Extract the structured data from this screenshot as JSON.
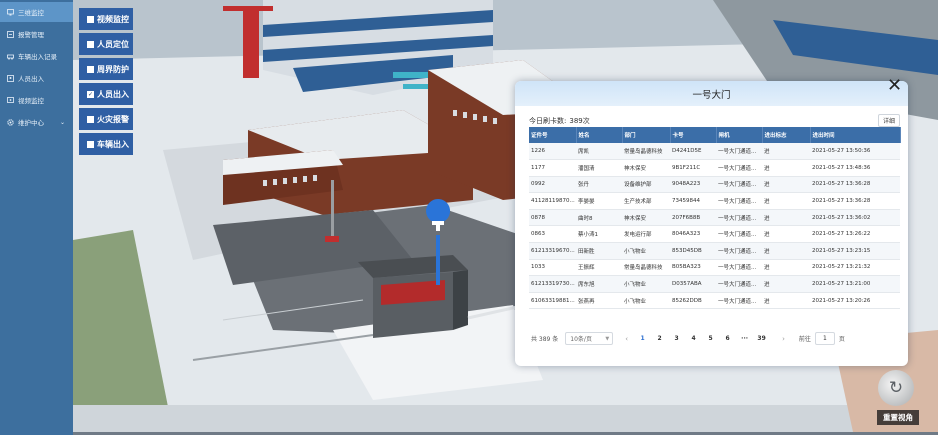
{
  "sidebar": {
    "items": [
      {
        "label": "三维监控",
        "icon": "monitor-icon"
      },
      {
        "label": "报警管理",
        "icon": "alarm-icon"
      },
      {
        "label": "车辆出入记录",
        "icon": "vehicle-icon"
      },
      {
        "label": "人员出入",
        "icon": "person-icon"
      },
      {
        "label": "视频监控",
        "icon": "video-icon"
      },
      {
        "label": "维护中心",
        "icon": "gear-icon"
      }
    ]
  },
  "layers": [
    {
      "label": "视频监控",
      "checked": false
    },
    {
      "label": "人员定位",
      "checked": false
    },
    {
      "label": "周界防护",
      "checked": false
    },
    {
      "label": "人员出入",
      "checked": true
    },
    {
      "label": "火灾报警",
      "checked": false
    },
    {
      "label": "车辆出入",
      "checked": false
    }
  ],
  "dialog": {
    "title": "一号大门",
    "count_label": "今日刷卡数:",
    "count_value": "389次",
    "detail_label": "详细",
    "columns": [
      "证件号",
      "姓名",
      "部门",
      "卡号",
      "闸机",
      "进出标志",
      "进出时间"
    ],
    "rows": [
      [
        "1226",
        "席凯",
        "常量岛晶德科技",
        "D4241D5E",
        "一号大门通道...",
        "进",
        "2021-05-27 13:50:36"
      ],
      [
        "1177",
        "潘国清",
        "神木保安",
        "9B1F211C",
        "一号大门通道...",
        "进",
        "2021-05-27 13:48:36"
      ],
      [
        "0992",
        "张丹",
        "设备维护部",
        "9048A223",
        "一号大门通道...",
        "进",
        "2021-05-27 13:36:28"
      ],
      [
        "41128119870...",
        "李晏晏",
        "生产技术部",
        "73459844",
        "一号大门通道...",
        "进",
        "2021-05-27 13:36:28"
      ],
      [
        "0878",
        "曲时8",
        "神木保安",
        "207F6B8B",
        "一号大门通道...",
        "进",
        "2021-05-27 13:36:02"
      ],
      [
        "0863",
        "蔡小涛1",
        "发电运行部",
        "8046A323",
        "一号大门通道...",
        "进",
        "2021-05-27 13:26:22"
      ],
      [
        "61213319670...",
        "田新胜",
        "小飞物业",
        "853D45DB",
        "一号大门通道...",
        "进",
        "2021-05-27 13:23:15"
      ],
      [
        "1033",
        "王振辉",
        "常量岛晶德科技",
        "B05BA323",
        "一号大门通道...",
        "进",
        "2021-05-27 13:21:32"
      ],
      [
        "61213319730...",
        "席东旭",
        "小飞物业",
        "D0357ABA",
        "一号大门通道...",
        "进",
        "2021-05-27 13:21:00"
      ],
      [
        "61063319881...",
        "张燕再",
        "小飞物业",
        "85262DDB",
        "一号大门通道...",
        "进",
        "2021-05-27 13:20:26"
      ]
    ],
    "pager": {
      "total": "共 389 条",
      "page_size": "10条/页",
      "prev": "‹",
      "pages": [
        "1",
        "2",
        "3",
        "4",
        "5",
        "6",
        "···",
        "39"
      ],
      "current": "1",
      "next": "›",
      "goto_label": "前往",
      "goto_value": "1",
      "goto_unit": "页"
    }
  },
  "reset_view": {
    "label": "重置视角",
    "icon": "reset-view-icon"
  },
  "colors": {
    "sidebar": "#3d6f9e",
    "sidebar_active": "#5d95c8",
    "layer_button": "#2f5fa4",
    "table_header": "#3b6ea8",
    "dialog_header": "#d6e8f9",
    "active_page": "#2d6fd0"
  }
}
